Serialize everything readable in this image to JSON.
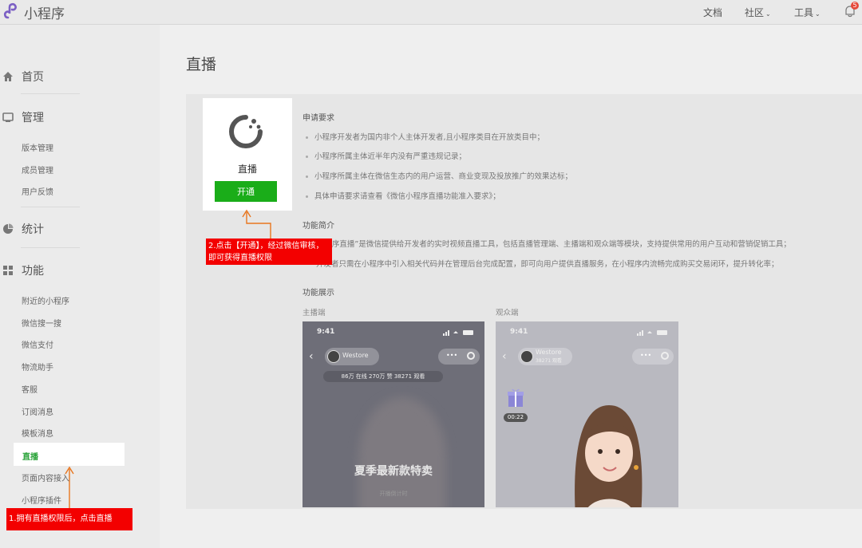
{
  "topbar": {
    "brand": "小程序",
    "nav": [
      {
        "label": "文档"
      },
      {
        "label": "社区"
      },
      {
        "label": "工具"
      }
    ],
    "notification_count": "5"
  },
  "sidebar": {
    "sections": [
      {
        "label": "首页",
        "icon": "home-icon"
      },
      {
        "label": "管理",
        "icon": "manage-icon",
        "items": [
          "版本管理",
          "成员管理",
          "用户反馈"
        ]
      },
      {
        "label": "统计",
        "icon": "stats-icon"
      },
      {
        "label": "功能",
        "icon": "features-icon",
        "items": [
          "附近的小程序",
          "微信搜一搜",
          "微信支付",
          "物流助手",
          "客服",
          "订阅消息",
          "模板消息",
          "直播",
          "页面内容接入",
          "小程序插件"
        ]
      }
    ],
    "active_item": "直播"
  },
  "main": {
    "title": "直播",
    "live_card": {
      "name": "直播",
      "button": "开通"
    },
    "requirements": {
      "heading": "申请要求",
      "items": [
        "小程序开发者为国内非个人主体开发者,且小程序类目在开放类目中；",
        "小程序所属主体近半年内没有严重违规记录；",
        "小程序所属主体在微信生态内的用户运营、商业变现及投放推广的效果达标；",
        "具体申请要求请查看《微信小程序直播功能准入要求》；"
      ]
    },
    "intro": {
      "heading": "功能简介",
      "line1": "“小程序直播”是微信提供给开发者的实时视频直播工具，包括直播管理端、主播端和观众端等模块，支持提供常用的用户互动和营销促销工具；",
      "line2": "开发者只需在小程序中引入相关代码并在管理后台完成配置，即可向用户提供直播服务，在小程序内流畅完成购买交易闭环，提升转化率；"
    },
    "showcase": {
      "heading": "功能展示",
      "anchor_label": "主播端",
      "viewer_label": "观众端",
      "anchor_phone": {
        "time": "9:41",
        "store": "Westore",
        "stats": "86万 在线  270万 赞  38271 观看",
        "promo": "夏季最新款特卖",
        "promo_sub": "开播倒计时"
      },
      "viewer_phone": {
        "time": "9:41",
        "store": "Westore",
        "store_sub": "38271 观看",
        "timer": "00:22"
      }
    }
  },
  "annotations": {
    "step2": "2.点击【开通】，经过微信审核，即可获得直播权限",
    "step1": "1.拥有直播权限后，点击直播"
  },
  "colors": {
    "primary_green": "#1aad19",
    "annotation_red": "#f30000",
    "arrow_orange": "#e8761f"
  }
}
